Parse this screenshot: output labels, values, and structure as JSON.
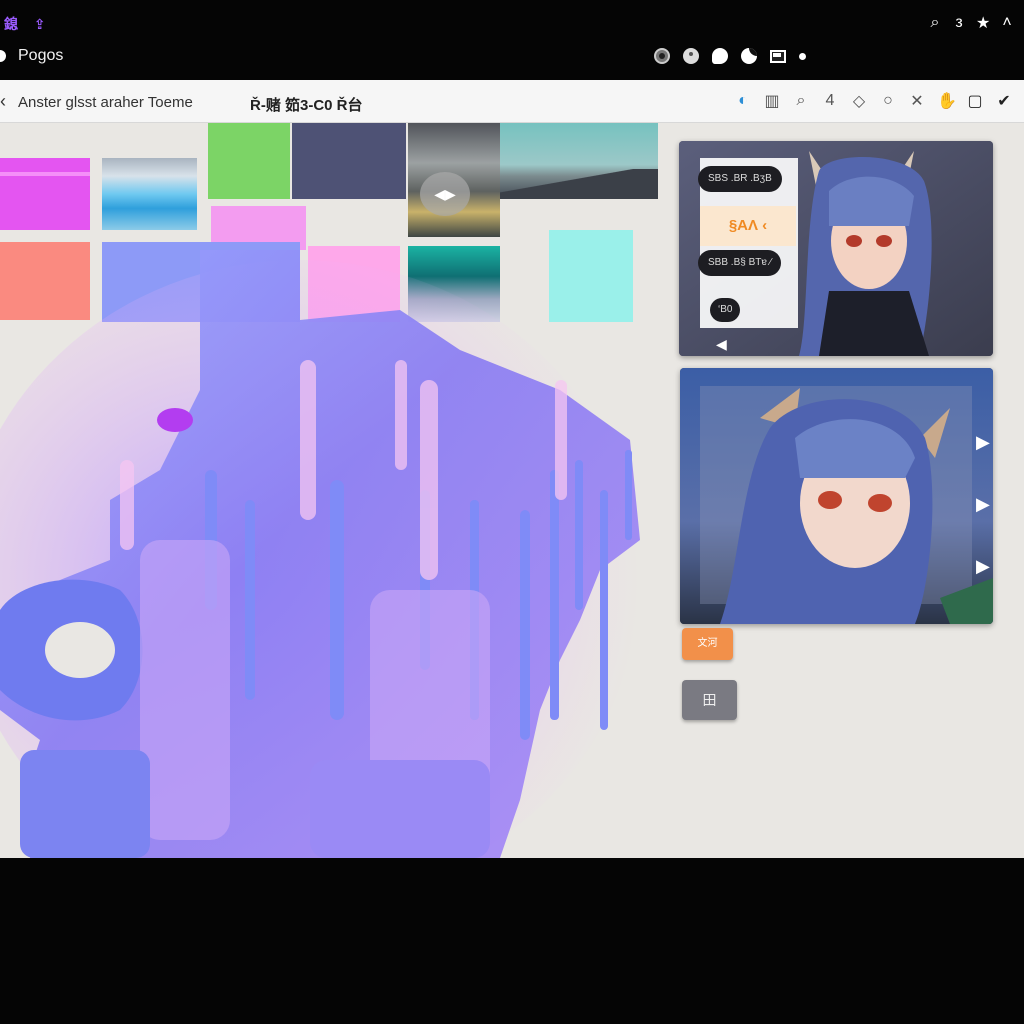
{
  "status_bar": {
    "left_icons": "鎴 ⇪",
    "right_icons": [
      "search-icon",
      "three-glyph",
      "star-icon",
      "chevron-up-icon"
    ],
    "right_glyphs": [
      "⌕",
      "з",
      "★",
      "˄"
    ]
  },
  "app": {
    "title": "Pogos",
    "media_icons": [
      "record-icon",
      "disc-icon",
      "drop-icon",
      "yin-icon",
      "frame-icon",
      "dot-icon"
    ]
  },
  "toolbar": {
    "back_glyph": "‹",
    "page_name": "Anster glsst araher Toeme",
    "subtitle": "Ř-赌 筎3-C0 Ř台",
    "tools": [
      {
        "name": "bubble-icon",
        "glyph": "◐"
      },
      {
        "name": "book-icon",
        "glyph": "▥"
      },
      {
        "name": "search-icon",
        "glyph": "⌕"
      },
      {
        "name": "four-icon",
        "glyph": "4"
      },
      {
        "name": "tag-icon",
        "glyph": "◇"
      },
      {
        "name": "circle-icon",
        "glyph": "○"
      },
      {
        "name": "close-icon",
        "glyph": "✕"
      },
      {
        "name": "hand-icon",
        "glyph": "✋"
      },
      {
        "name": "square-icon",
        "glyph": "▢"
      },
      {
        "name": "check-icon",
        "glyph": "✔"
      }
    ]
  },
  "thumbnails": {
    "video_play_glyph": "◀▶"
  },
  "card1": {
    "chip1": "SBS .BR .BʒB",
    "orange_label": "§AɅ ‹",
    "chip2": "SBB .B§ BTɐ ∕",
    "chip3": "‘B0",
    "prev_glyph": "◀"
  },
  "card2": {
    "arrow_glyph": "▶"
  },
  "buttons": {
    "orange": "文河",
    "gray": "田"
  },
  "colors": {
    "swatch_magenta": "#e455f1",
    "swatch_salmon": "#fa8a80",
    "swatch_green": "#7cd466",
    "swatch_slate": "#4e5275",
    "swatch_pink": "#f39cf0",
    "swatch_blue": "#8d9af7",
    "swatch_cyan": "#9af0ea",
    "accent_orange": "#f2904a"
  }
}
